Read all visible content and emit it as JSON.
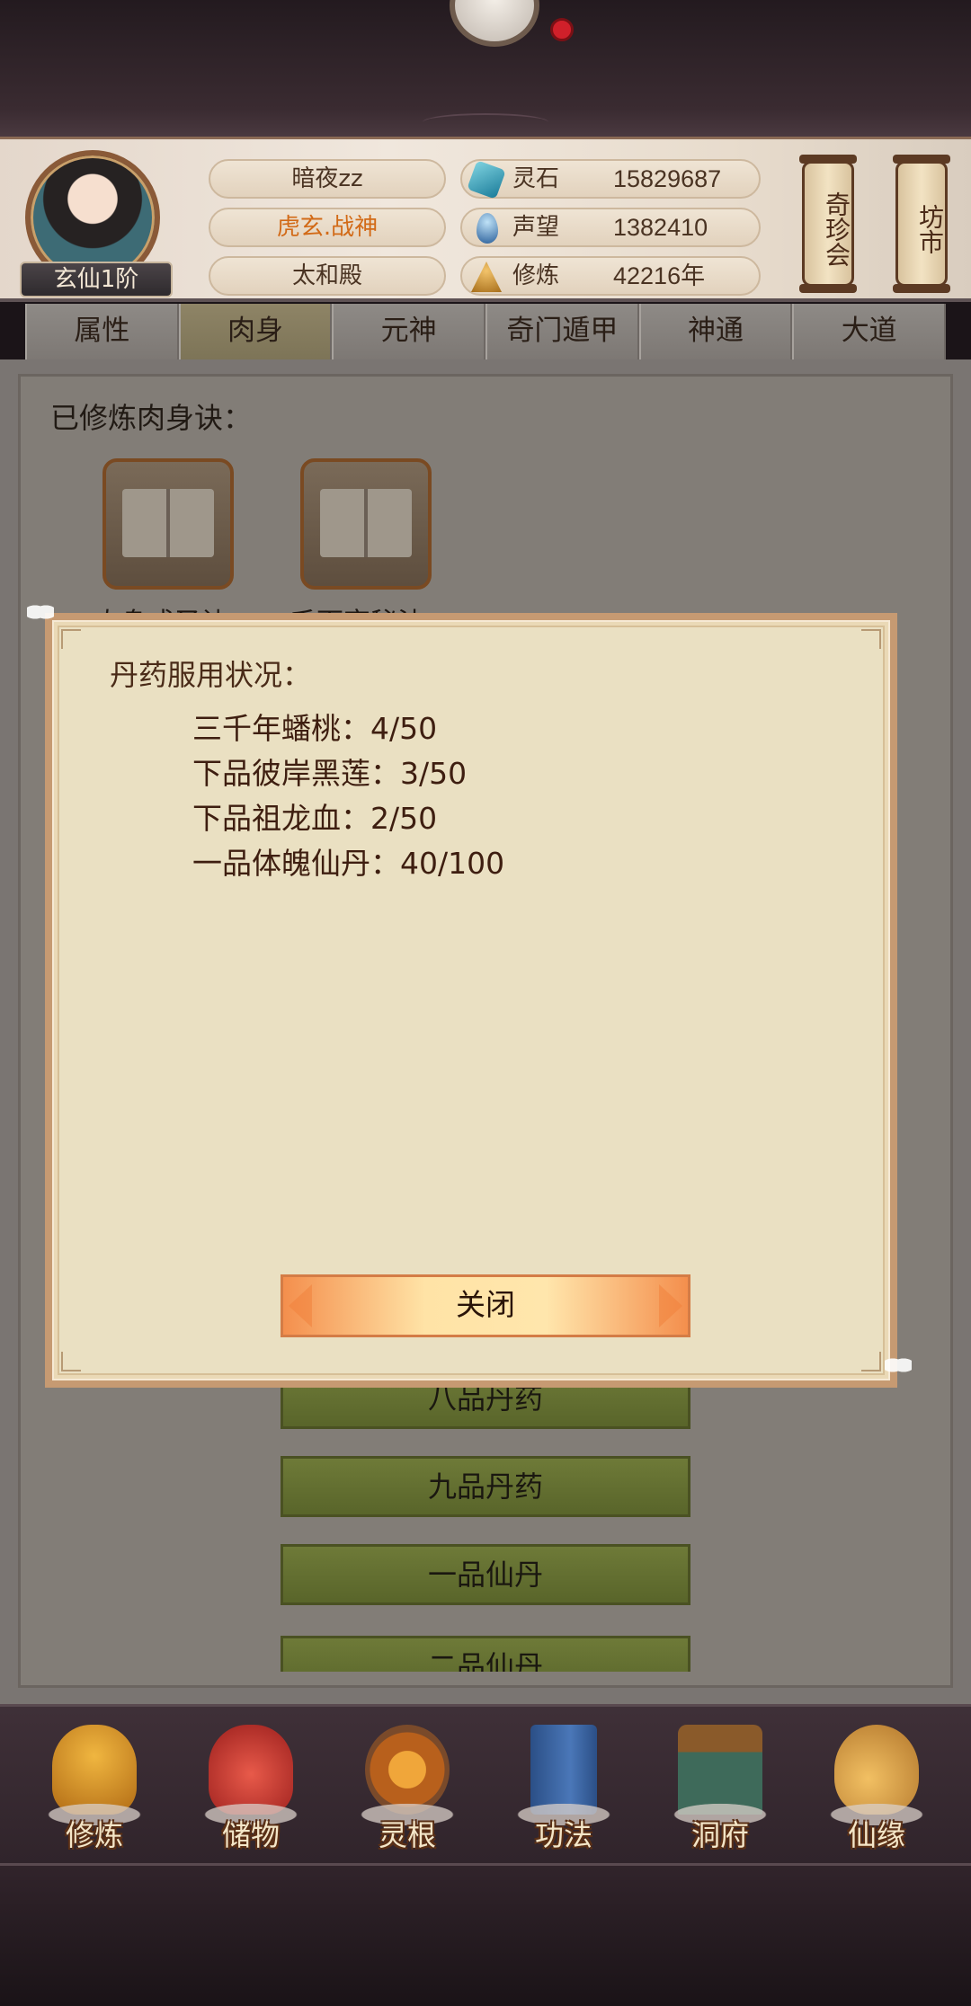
{
  "player": {
    "rank": "玄仙1阶",
    "name": "暗夜zz",
    "title": "虎玄.战神",
    "sect": "太和殿"
  },
  "stats": [
    {
      "label": "灵石",
      "value": "15829687",
      "icon": "spirit-stone-icon"
    },
    {
      "label": "声望",
      "value": "1382410",
      "icon": "reputation-icon"
    },
    {
      "label": "修炼",
      "value": "42216年",
      "icon": "cultivation-icon"
    }
  ],
  "side_buttons": {
    "treasure_fair": "奇珍会",
    "market": "坊市"
  },
  "tabs": [
    "属性",
    "肉身",
    "元神",
    "奇门遁甲",
    "神通",
    "大道"
  ],
  "active_tab": "肉身",
  "main": {
    "section_label": "已修炼肉身诀：",
    "books": [
      "肉身成圣诀",
      "千面变秘法"
    ],
    "pill_grades": [
      "八品丹药",
      "九品丹药",
      "一品仙丹",
      "二品仙丹"
    ]
  },
  "modal": {
    "title": "丹药服用状况：",
    "items": [
      "三千年蟠桃：4/50",
      "下品彼岸黑莲：3/50",
      "下品祖龙血：2/50",
      "一品体魄仙丹：40/100"
    ],
    "close_label": "关闭"
  },
  "bottom_nav": [
    "修炼",
    "储物",
    "灵根",
    "功法",
    "洞府",
    "仙缘"
  ],
  "colors": {
    "modal_bg": "#eae0c2",
    "modal_border": "#c69a72",
    "close_button": "#f48f4d",
    "pill_button": "#6e7a38",
    "title_orange": "#d26a17"
  }
}
